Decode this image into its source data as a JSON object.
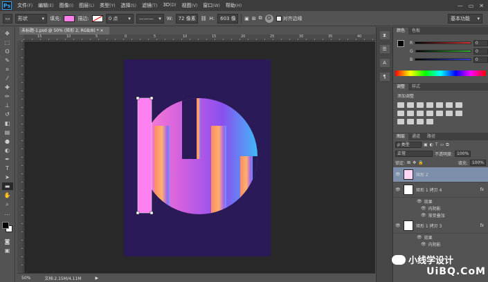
{
  "app": {
    "logo": "Ps"
  },
  "menu": [
    {
      "label": "文件",
      "key": "F"
    },
    {
      "label": "编辑",
      "key": "E"
    },
    {
      "label": "图像",
      "key": "I"
    },
    {
      "label": "图层",
      "key": "L"
    },
    {
      "label": "类型",
      "key": "Y"
    },
    {
      "label": "选择",
      "key": "S"
    },
    {
      "label": "滤镜",
      "key": "T"
    },
    {
      "label": "3D",
      "key": "D"
    },
    {
      "label": "视图",
      "key": "V"
    },
    {
      "label": "窗口",
      "key": "W"
    },
    {
      "label": "帮助",
      "key": "H"
    }
  ],
  "window_controls": {
    "minimize": "—",
    "restore": "▭",
    "close": "✕"
  },
  "options": {
    "mode": "形状",
    "fill_label": "填充:",
    "fill_color": "#ff7fe8",
    "stroke_label": "描边:",
    "stroke_width": "0 点",
    "w_label": "W:",
    "w_value": "72 像素",
    "h_label": "H:",
    "h_value": "603 像",
    "align_edges": "对齐边缘",
    "workspace": "基本功能"
  },
  "document": {
    "tab": "未标题-1.psd @ 50% (矩形 2, RGB/8) * ×",
    "zoom": "50%",
    "doc_info": "文档:2.15M/4.11M",
    "ruler_top": [
      "15",
      "10",
      "5",
      "0",
      "5",
      "10",
      "15",
      "20",
      "25",
      "30",
      "35",
      "40"
    ],
    "background_color": "#2a1a58"
  },
  "color_panel": {
    "tabs": [
      "颜色",
      "色板"
    ],
    "channels": [
      {
        "label": "R",
        "value": "0",
        "color": "#d93030"
      },
      {
        "label": "G",
        "value": "0",
        "color": "#30b030"
      },
      {
        "label": "B",
        "value": "0",
        "color": "#3040d0"
      }
    ]
  },
  "adjust_panel": {
    "tabs": [
      "调整",
      "样式"
    ],
    "title": "添加调整"
  },
  "layers_panel": {
    "tabs": [
      "图层",
      "通道",
      "路径"
    ],
    "filter": "ρ 类型",
    "blend_mode": "正常",
    "opacity_label": "不透明度:",
    "opacity": "100%",
    "lock_label": "锁定:",
    "fill_label": "填充:",
    "fill": "100%",
    "layers": [
      {
        "name": "矩形 2",
        "selected": true,
        "fx": false
      },
      {
        "name": "矩形 1 拷贝 4",
        "selected": false,
        "fx": true
      },
      {
        "name": "矩形 1 拷贝 3",
        "selected": false,
        "fx": true
      }
    ],
    "effects_label": "效果",
    "effect_inner": "内阴影",
    "effect_gradient": "渐变叠加",
    "effect_inner2": "内阴影"
  },
  "watermark": {
    "text": "小线学设计",
    "brand": "UiBQ.CoM"
  }
}
